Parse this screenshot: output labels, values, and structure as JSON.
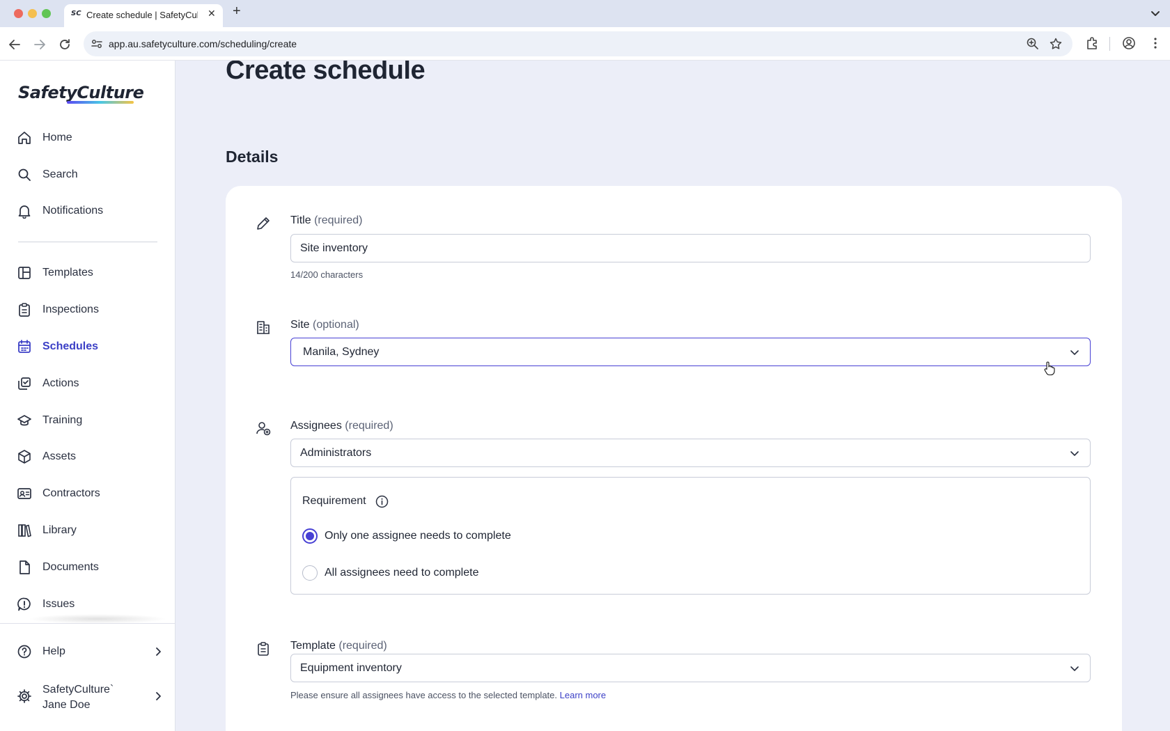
{
  "browser": {
    "tab_favicon": "SC",
    "tab_title": "Create schedule | SafetyCulture",
    "url": "app.au.safetyculture.com/scheduling/create"
  },
  "sidebar": {
    "logo_text": "SafetyCulture",
    "items": [
      {
        "label": "Home",
        "icon": "home-icon"
      },
      {
        "label": "Search",
        "icon": "search-icon"
      },
      {
        "label": "Notifications",
        "icon": "bell-icon"
      },
      {
        "label": "Templates",
        "icon": "templates-icon"
      },
      {
        "label": "Inspections",
        "icon": "clipboard-icon"
      },
      {
        "label": "Schedules",
        "icon": "calendar-icon",
        "active": true
      },
      {
        "label": "Actions",
        "icon": "actions-icon"
      },
      {
        "label": "Training",
        "icon": "graduation-cap-icon"
      },
      {
        "label": "Assets",
        "icon": "cube-icon"
      },
      {
        "label": "Contractors",
        "icon": "id-card-icon"
      },
      {
        "label": "Library",
        "icon": "books-icon"
      },
      {
        "label": "Documents",
        "icon": "document-icon"
      },
      {
        "label": "Issues",
        "icon": "alert-icon"
      }
    ],
    "help_label": "Help",
    "org_name": "SafetyCulture`",
    "user_name": "Jane Doe"
  },
  "main": {
    "page_title": "Create schedule",
    "section_title": "Details",
    "title_field": {
      "label": "Title",
      "hint": "(required)",
      "value": "Site inventory",
      "counter": "14/200 characters"
    },
    "site_field": {
      "label": "Site",
      "hint": "(optional)",
      "value": "Manila, Sydney"
    },
    "assignees_field": {
      "label": "Assignees",
      "hint": "(required)",
      "value": "Administrators"
    },
    "requirement": {
      "title": "Requirement",
      "options": [
        {
          "label": "Only one assignee needs to complete",
          "checked": true
        },
        {
          "label": "All assignees need to complete",
          "checked": false
        }
      ]
    },
    "template_field": {
      "label": "Template",
      "hint": "(required)",
      "value": "Equipment inventory",
      "helper": "Please ensure all assignees have access to the selected template.",
      "learn_more": "Learn more"
    }
  },
  "colors": {
    "accent": "#4740d4",
    "page_bg": "#eceef8",
    "active_nav": "#3b3fc6"
  }
}
